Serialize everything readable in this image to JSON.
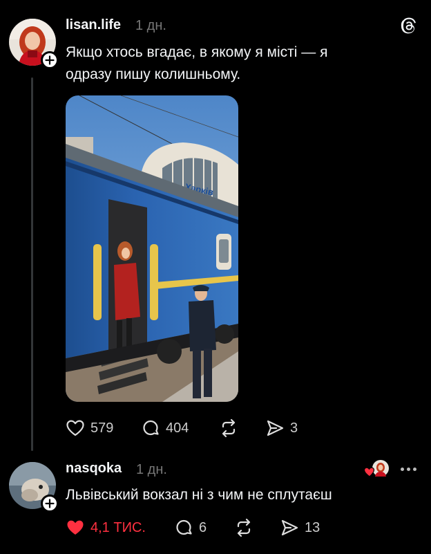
{
  "post": {
    "username": "lisan.life",
    "time": "1 дн.",
    "text_line1": "Якщо хтось вгадає, в якому я місті — я",
    "text_line2": "одразу пишу колишньому.",
    "station_sign": "Харків",
    "actions": {
      "likes": "579",
      "comments": "404",
      "reposts": "",
      "shares": "3"
    }
  },
  "reply": {
    "username": "nasqoka",
    "time": "1 дн.",
    "text": "Львівський вокзал ні з чим не сплутаєш",
    "actions": {
      "likes": "4,1 тис.",
      "comments": "6",
      "reposts": "",
      "shares": "13"
    }
  },
  "icons": {
    "logo": "threads-logo-icon",
    "like": "heart-icon",
    "comment": "comment-bubble-icon",
    "repost": "repost-icon",
    "share": "send-icon",
    "more": "more-dots-icon"
  },
  "colors": {
    "background": "#000000",
    "text": "#f3f5f7",
    "muted": "#777777",
    "liked": "#ff3040"
  }
}
